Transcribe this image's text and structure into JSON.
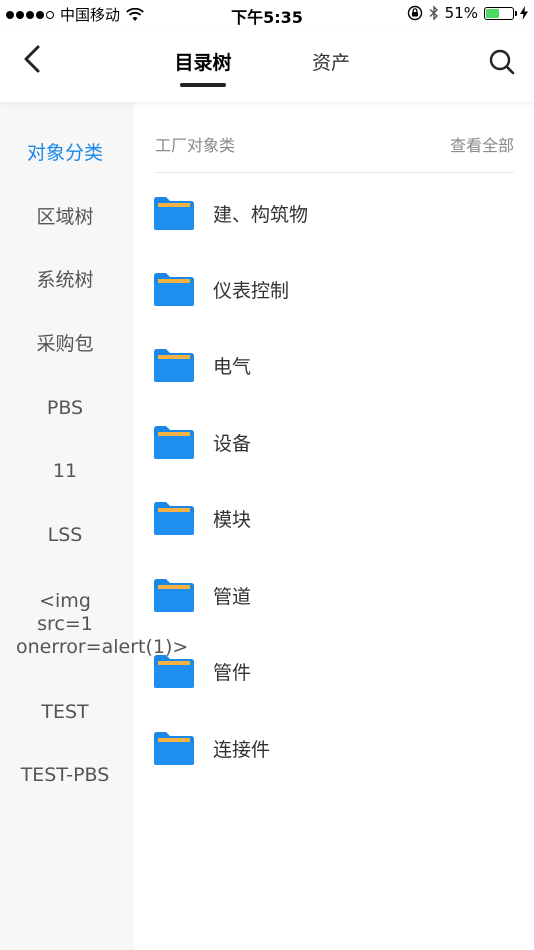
{
  "status_bar": {
    "carrier": "中国移动",
    "time": "下午5:35",
    "battery_text": "51%",
    "battery_level": 0.51,
    "battery_color": "#4cd964",
    "signal_bars_filled": 4,
    "signal_bars_total": 5
  },
  "nav": {
    "back_icon": "chevron-left-icon",
    "tabs": [
      {
        "label": "目录树",
        "active": true
      },
      {
        "label": "资产",
        "active": false
      }
    ],
    "search_icon": "search-icon"
  },
  "sidebar": {
    "items": [
      {
        "label": "对象分类",
        "active": true
      },
      {
        "label": "区域树",
        "active": false
      },
      {
        "label": "系统树",
        "active": false
      },
      {
        "label": "采购包",
        "active": false
      },
      {
        "label": "PBS",
        "active": false
      },
      {
        "label": "11",
        "active": false
      },
      {
        "label": "LSS",
        "active": false
      },
      {
        "label": "<img src=1 onerror=alert(1)>",
        "active": false
      },
      {
        "label": "TEST",
        "active": false
      },
      {
        "label": "TEST-PBS",
        "active": false
      }
    ],
    "active_color": "#1a88e6"
  },
  "main": {
    "section_title": "工厂对象类",
    "view_all_label": "查看全部",
    "folder_icon": "folder-icon",
    "folder_color": "#1a88e6",
    "folders": [
      {
        "label": "建、构筑物"
      },
      {
        "label": "仪表控制"
      },
      {
        "label": "电气"
      },
      {
        "label": "设备"
      },
      {
        "label": "模块"
      },
      {
        "label": "管道"
      },
      {
        "label": "管件"
      },
      {
        "label": "连接件"
      }
    ]
  }
}
